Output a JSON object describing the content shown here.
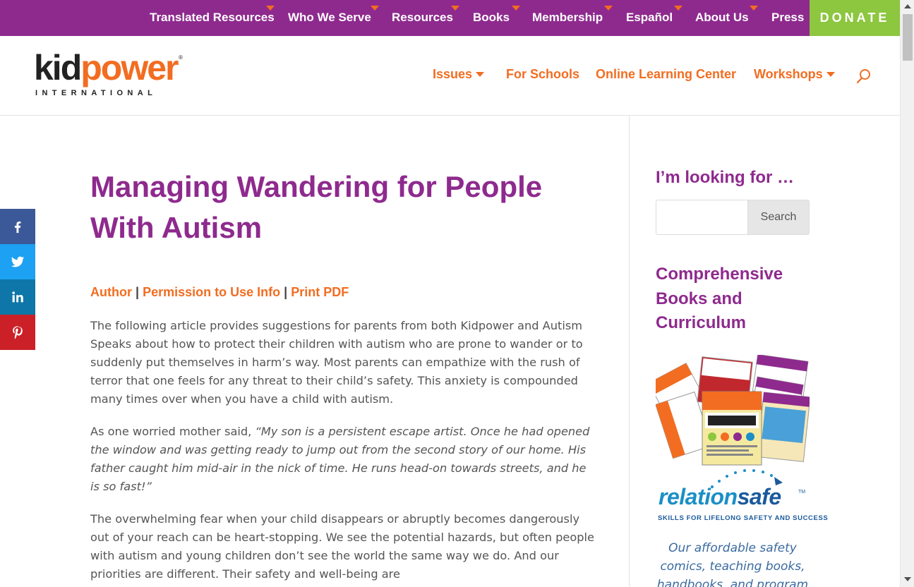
{
  "topnav": {
    "items": [
      {
        "label": "Translated Resources",
        "has_dropdown": true
      },
      {
        "label": "Who We Serve",
        "has_dropdown": true
      },
      {
        "label": "Resources",
        "has_dropdown": true
      },
      {
        "label": "Books",
        "has_dropdown": true
      },
      {
        "label": "Membership",
        "has_dropdown": true
      },
      {
        "label": "Español",
        "has_dropdown": true
      },
      {
        "label": "About Us",
        "has_dropdown": true
      },
      {
        "label": "Press",
        "has_dropdown": false
      }
    ],
    "donate_label": "DONATE"
  },
  "logo": {
    "kid": "kid",
    "power": "power",
    "reg": "®",
    "subtitle": "INTERNATIONAL"
  },
  "mainnav": {
    "items": [
      {
        "label": "Issues",
        "has_dropdown": true
      },
      {
        "label": "For Schools",
        "has_dropdown": false
      },
      {
        "label": "Online Learning Center",
        "has_dropdown": false
      },
      {
        "label": "Workshops",
        "has_dropdown": true
      }
    ]
  },
  "share": {
    "items": [
      {
        "network": "facebook",
        "icon": "facebook-icon",
        "color": "#3b5998"
      },
      {
        "network": "twitter",
        "icon": "twitter-icon",
        "color": "#1da1f2"
      },
      {
        "network": "linkedin",
        "icon": "linkedin-icon",
        "color": "#0e76a8"
      },
      {
        "network": "pinterest",
        "icon": "pinterest-icon",
        "color": "#cb2027"
      }
    ]
  },
  "article": {
    "title": "Managing Wandering for People With Autism",
    "meta": {
      "author": "Author",
      "permission": "Permission to Use Info",
      "print": "Print PDF",
      "separator": "|"
    },
    "p1": "The following article provides suggestions for parents from both Kidpower and Autism Speaks about how to protect their children with autism who are prone to wander or to suddenly put themselves in harm’s way.  Most parents can empathize with the rush of terror that one feels for any threat to their child’s safety. This anxiety is compounded many times over when you have a child with autism.",
    "p2_lead": "As one worried mother said, ",
    "p2_quote": "“My son is a persistent escape artist. Once he had opened the window and was getting ready to jump out from the second story of our home. His father caught him mid-air in the nick of time.  He runs head-on towards streets, and he is so fast!”",
    "p3": "The overwhelming fear when your child disappears or abruptly becomes dangerously out of your reach can be heart-stopping.  We see the potential hazards, but often people with autism and young children don’t see the world the same way we do. And our priorities are different. Their safety and well-being are"
  },
  "sidebar": {
    "search_heading": "I’m looking for …",
    "search_value": "",
    "search_button": "Search",
    "books_heading": "Comprehensive Books and Curriculum",
    "relationsafe": {
      "word_a": "relation",
      "word_b": "safe",
      "tm": "TM",
      "tagline": "SKILLS FOR LIFELONG SAFETY AND SUCCESS"
    },
    "caption": "Our affordable safety comics, teaching books, handbooks, and program"
  },
  "colors": {
    "purple": "#8e2a8e",
    "orange": "#f26d21",
    "green": "#8dc63f"
  }
}
